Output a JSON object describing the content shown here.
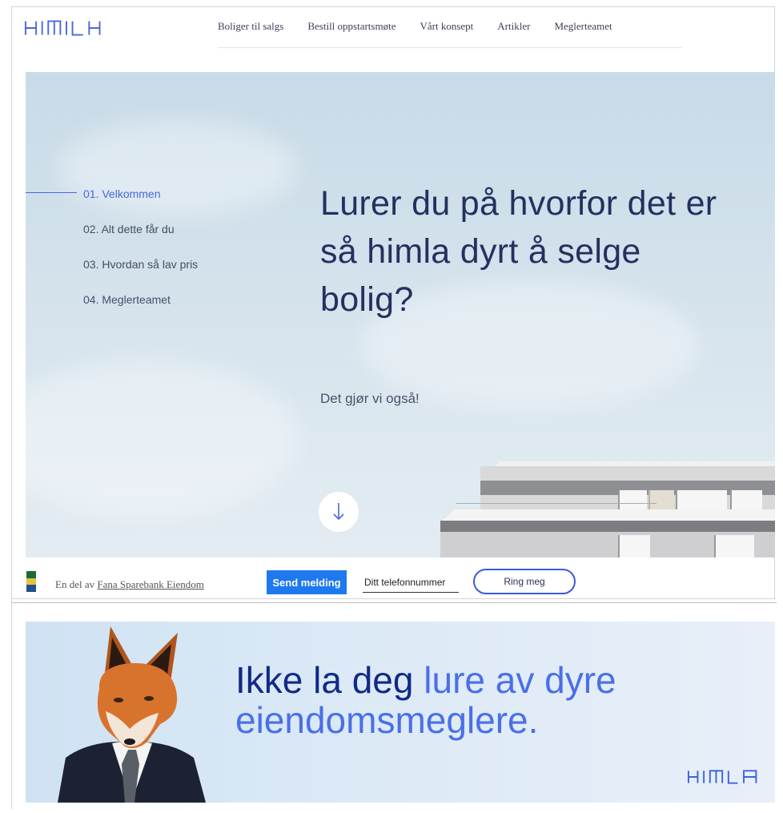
{
  "brand": {
    "name": "HIMLA",
    "color": "#4a66e0"
  },
  "nav": {
    "items": [
      {
        "label": "Boliger til salgs"
      },
      {
        "label": "Bestill oppstartsmøte"
      },
      {
        "label": "Vårt konsept"
      },
      {
        "label": "Artikler"
      },
      {
        "label": "Meglerteamet"
      }
    ]
  },
  "side_nav": {
    "items": [
      {
        "label": "01. Velkommen",
        "active": true
      },
      {
        "label": "02. Alt dette får du",
        "active": false
      },
      {
        "label": "03. Hvordan så lav pris",
        "active": false
      },
      {
        "label": "04. Meglerteamet",
        "active": false
      }
    ]
  },
  "hero": {
    "title": "Lurer du på hvorfor det er så himla dyrt å selge bolig?",
    "subtitle": "Det gjør vi også!",
    "scroll_icon": "arrow-down-icon"
  },
  "bottom_bar": {
    "prefix": "En del av",
    "link_text": "Fana Sparebank Eiendom",
    "send_label": "Send melding",
    "phone_placeholder": "Ditt telefonnummer",
    "ring_label": "Ring meg"
  },
  "banner": {
    "title_part1": "Ikke la deg",
    "title_part2": "lure av dyre eiendomsmeglere.",
    "logo": "HIMLA"
  },
  "colors": {
    "accent": "#4a66e0",
    "send_button": "#1e79ef",
    "title_dark": "#25305f",
    "banner_title": "#112a86"
  }
}
